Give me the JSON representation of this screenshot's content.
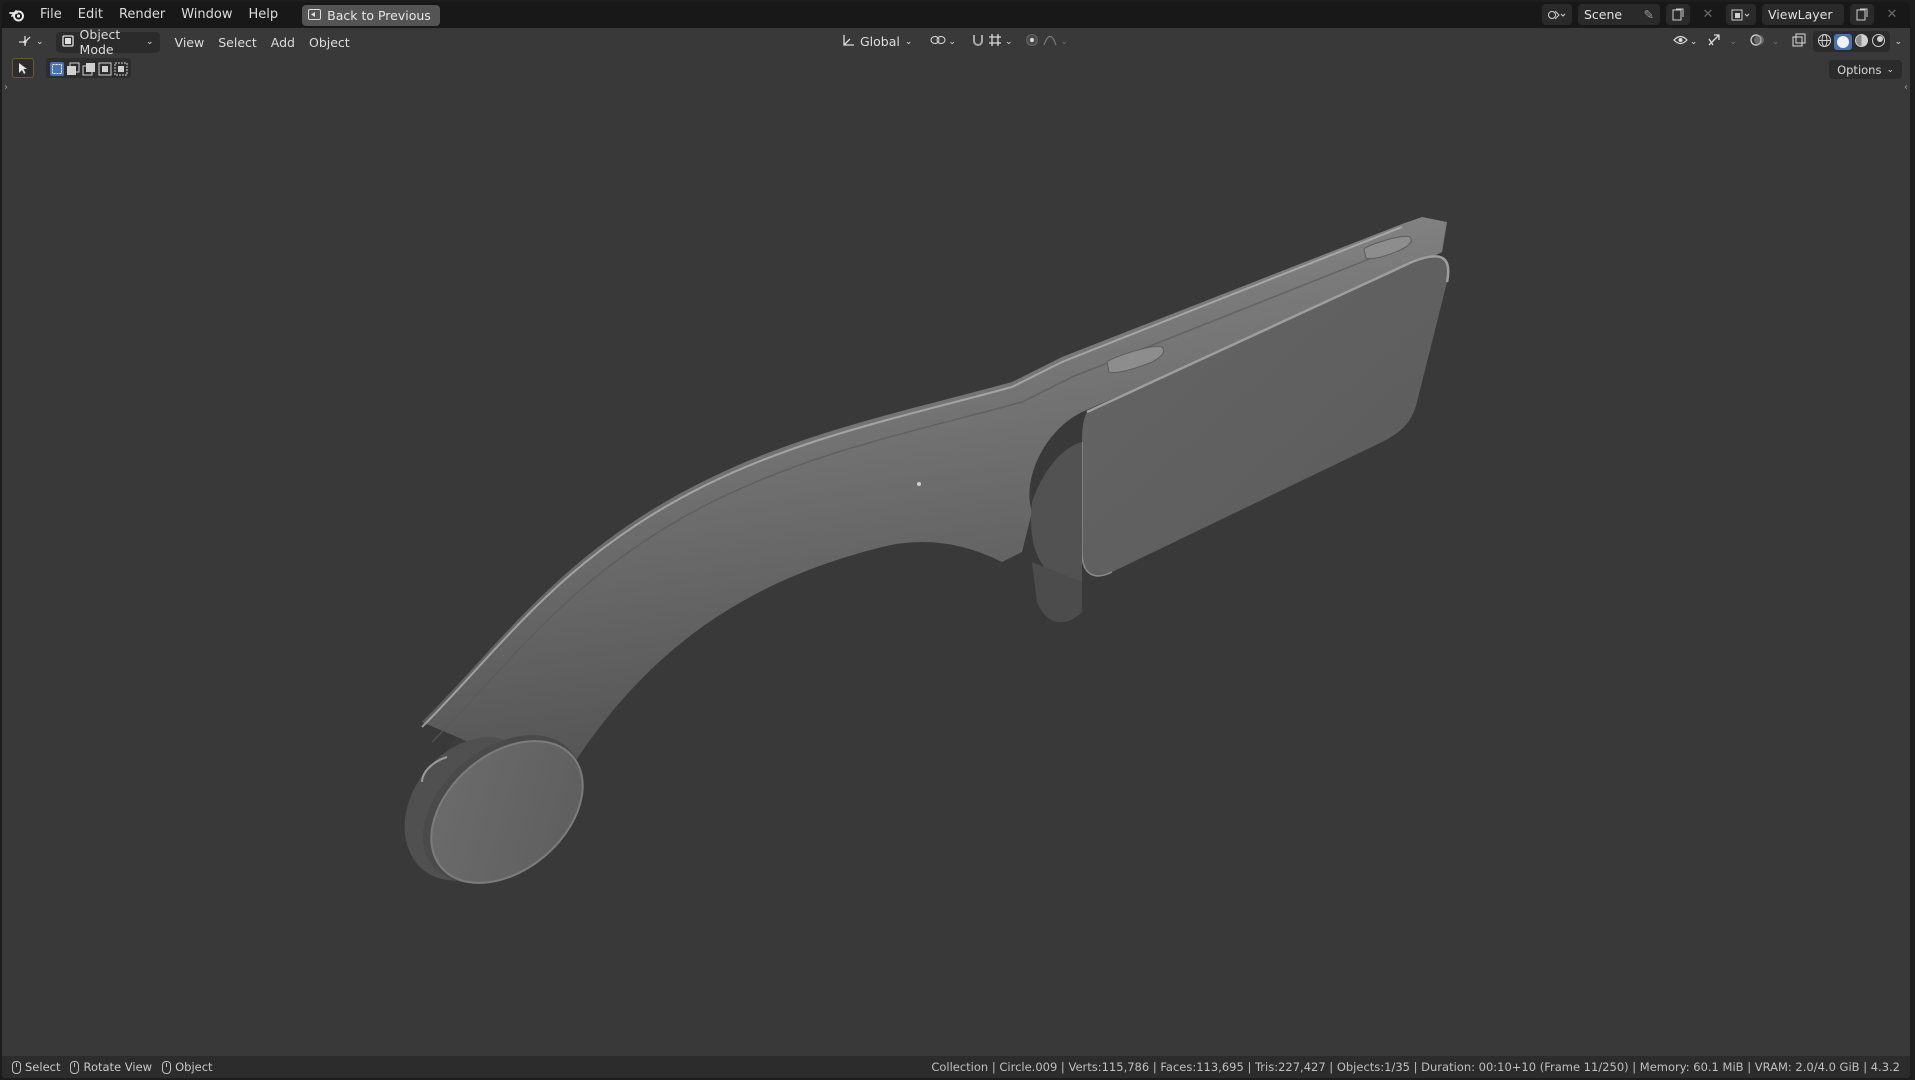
{
  "topbar": {
    "menus": [
      "File",
      "Edit",
      "Render",
      "Window",
      "Help"
    ],
    "back_button": "Back to Previous",
    "scene_name": "Scene",
    "view_layer_name": "ViewLayer"
  },
  "header": {
    "mode": "Object Mode",
    "menus": [
      "View",
      "Select",
      "Add",
      "Object"
    ],
    "transform_orientation": "Global",
    "options_label": "Options"
  },
  "statusbar": {
    "hints": [
      {
        "icon": "mouse-left-icon",
        "label": "Select"
      },
      {
        "icon": "mouse-middle-icon",
        "label": "Rotate View"
      },
      {
        "icon": "mouse-right-icon",
        "label": "Object"
      }
    ],
    "stats": "Collection | Circle.009 | Verts:115,786 | Faces:113,695 | Tris:227,427 | Objects:1/35 | Duration: 00:10+10 (Frame 11/250) | Memory: 60.1 MiB | VRAM: 2.0/4.0 GiB | 4.3.2"
  },
  "colors": {
    "viewport_bg": "#393939",
    "topbar_bg": "#181818",
    "model_base": "#6b6b6b",
    "accent": "#4772b3"
  }
}
